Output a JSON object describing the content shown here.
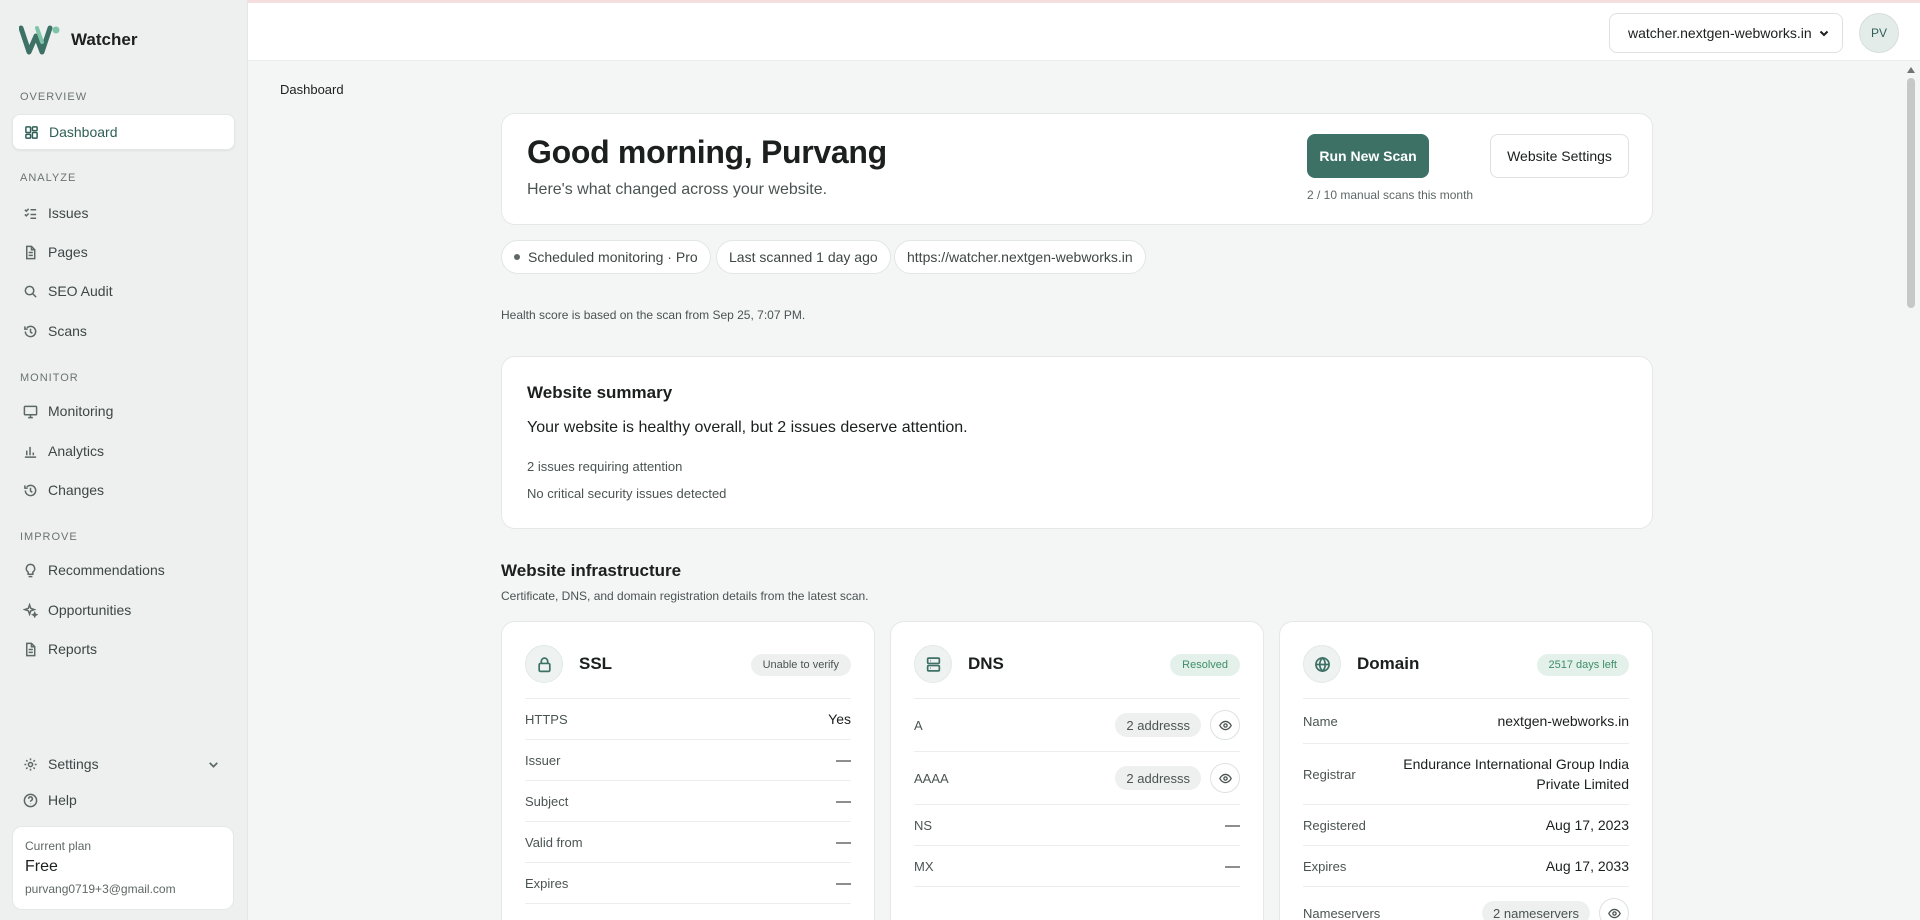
{
  "brand": {
    "name": "Watcher"
  },
  "nav": {
    "sections": [
      {
        "label": "OVERVIEW"
      },
      {
        "label": "ANALYZE"
      },
      {
        "label": "MONITOR"
      },
      {
        "label": "IMPROVE"
      }
    ],
    "items": [
      {
        "label": "Dashboard",
        "icon": "dashboard-icon",
        "active": true
      },
      {
        "label": "Issues",
        "icon": "list-check-icon"
      },
      {
        "label": "Pages",
        "icon": "file-icon"
      },
      {
        "label": "SEO Audit",
        "icon": "search-icon"
      },
      {
        "label": "Scans",
        "icon": "history-icon"
      },
      {
        "label": "Monitoring",
        "icon": "monitor-icon"
      },
      {
        "label": "Analytics",
        "icon": "bar-chart-icon"
      },
      {
        "label": "Changes",
        "icon": "history-icon"
      },
      {
        "label": "Recommendations",
        "icon": "lightbulb-icon"
      },
      {
        "label": "Opportunities",
        "icon": "sparkles-icon"
      },
      {
        "label": "Reports",
        "icon": "file-icon"
      }
    ],
    "settings": "Settings",
    "help": "Help"
  },
  "plan": {
    "label": "Current plan",
    "name": "Free",
    "email": "purvang0719+3@gmail.com"
  },
  "topbar": {
    "site": "watcher.nextgen-webworks.in",
    "avatar_initials": "PV"
  },
  "breadcrumb": "Dashboard",
  "greeting": {
    "title": "Good morning, Purvang",
    "subtitle": "Here's what changed across your website.",
    "run_scan": "Run New Scan",
    "website_settings": "Website Settings",
    "quota": "2 / 10 manual scans this month"
  },
  "pills": {
    "monitoring": "Scheduled monitoring · Pro",
    "last_scanned": "Last scanned 1 day ago",
    "url": "https://watcher.nextgen-webworks.in"
  },
  "health_note": "Health score is based on the scan from Sep 25, 7:07 PM.",
  "summary": {
    "title": "Website summary",
    "text": "Your website is healthy overall, but 2 issues deserve attention.",
    "line1": "2 issues requiring attention",
    "line2": "No critical security issues detected"
  },
  "infrastructure": {
    "title": "Website infrastructure",
    "subtitle": "Certificate, DNS, and domain registration details from the latest scan.",
    "ssl": {
      "title": "SSL",
      "badge": "Unable to verify",
      "rows": [
        {
          "k": "HTTPS",
          "v": "Yes"
        },
        {
          "k": "Issuer",
          "v": "—"
        },
        {
          "k": "Subject",
          "v": "—"
        },
        {
          "k": "Valid from",
          "v": "—"
        },
        {
          "k": "Expires",
          "v": "—"
        }
      ]
    },
    "dns": {
      "title": "DNS",
      "badge": "Resolved",
      "rows": [
        {
          "k": "A",
          "chip": "2 addresss"
        },
        {
          "k": "AAAA",
          "chip": "2 addresss"
        },
        {
          "k": "NS",
          "v": "—"
        },
        {
          "k": "MX",
          "v": "—"
        }
      ]
    },
    "domain": {
      "title": "Domain",
      "badge": "2517 days left",
      "rows": [
        {
          "k": "Name",
          "v": "nextgen-webworks.in"
        },
        {
          "k": "Registrar",
          "v1": "Endurance International Group India",
          "v2": "Private Limited"
        },
        {
          "k": "Registered",
          "v": "Aug 17, 2023"
        },
        {
          "k": "Expires",
          "v": "Aug 17, 2033"
        },
        {
          "k": "Nameservers",
          "chip": "2 nameservers"
        }
      ]
    }
  },
  "colors": {
    "primary": "#3e7166",
    "accent_green": "#3e8d6a",
    "sidebar_bg": "#edf0ef"
  }
}
